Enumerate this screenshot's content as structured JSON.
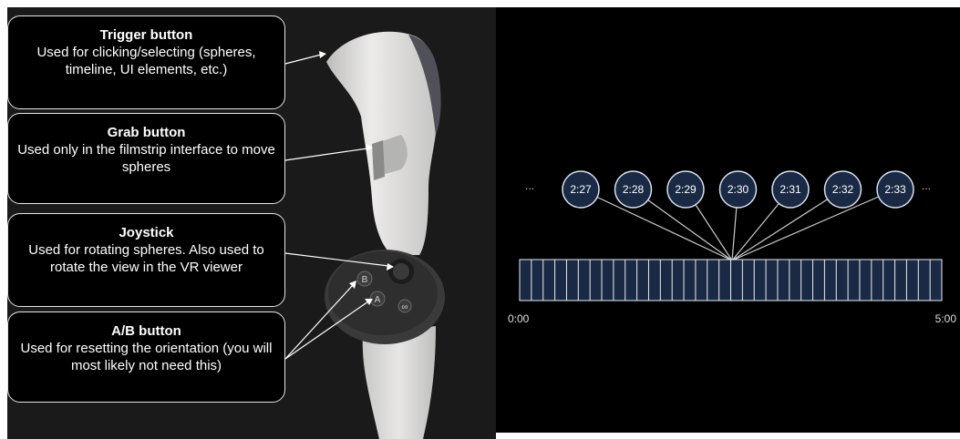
{
  "callouts": [
    {
      "title": "Trigger button",
      "description": "Used for clicking/selecting (spheres, timeline, UI elements, etc.)"
    },
    {
      "title": "Grab button",
      "description": "Used only in the filmstrip interface to move spheres"
    },
    {
      "title": "Joystick",
      "description": "Used for rotating spheres. Also used to rotate the view in the VR viewer"
    },
    {
      "title": "A/B button",
      "description": "Used for resetting the orientation (you will most likely not need this)"
    }
  ],
  "controller": {
    "button_a": "A",
    "button_b": "B",
    "menu_symbol": "∞"
  },
  "filmstrip": {
    "timestamps": [
      "2:27",
      "2:28",
      "2:29",
      "2:30",
      "2:31",
      "2:32",
      "2:33"
    ],
    "ellipsis_left": "...",
    "ellipsis_right": "...",
    "start_time": "0:00",
    "end_time": "5:00",
    "segment_count": 36
  },
  "colors": {
    "left_background": "#1a1a1a",
    "right_background": "#000000",
    "node_fill": "#1b2a44",
    "node_stroke": "#d6e2f2",
    "line_color": "#cccccc",
    "controller_body": "#dcdcda",
    "controller_face": "#2e2e2e"
  }
}
